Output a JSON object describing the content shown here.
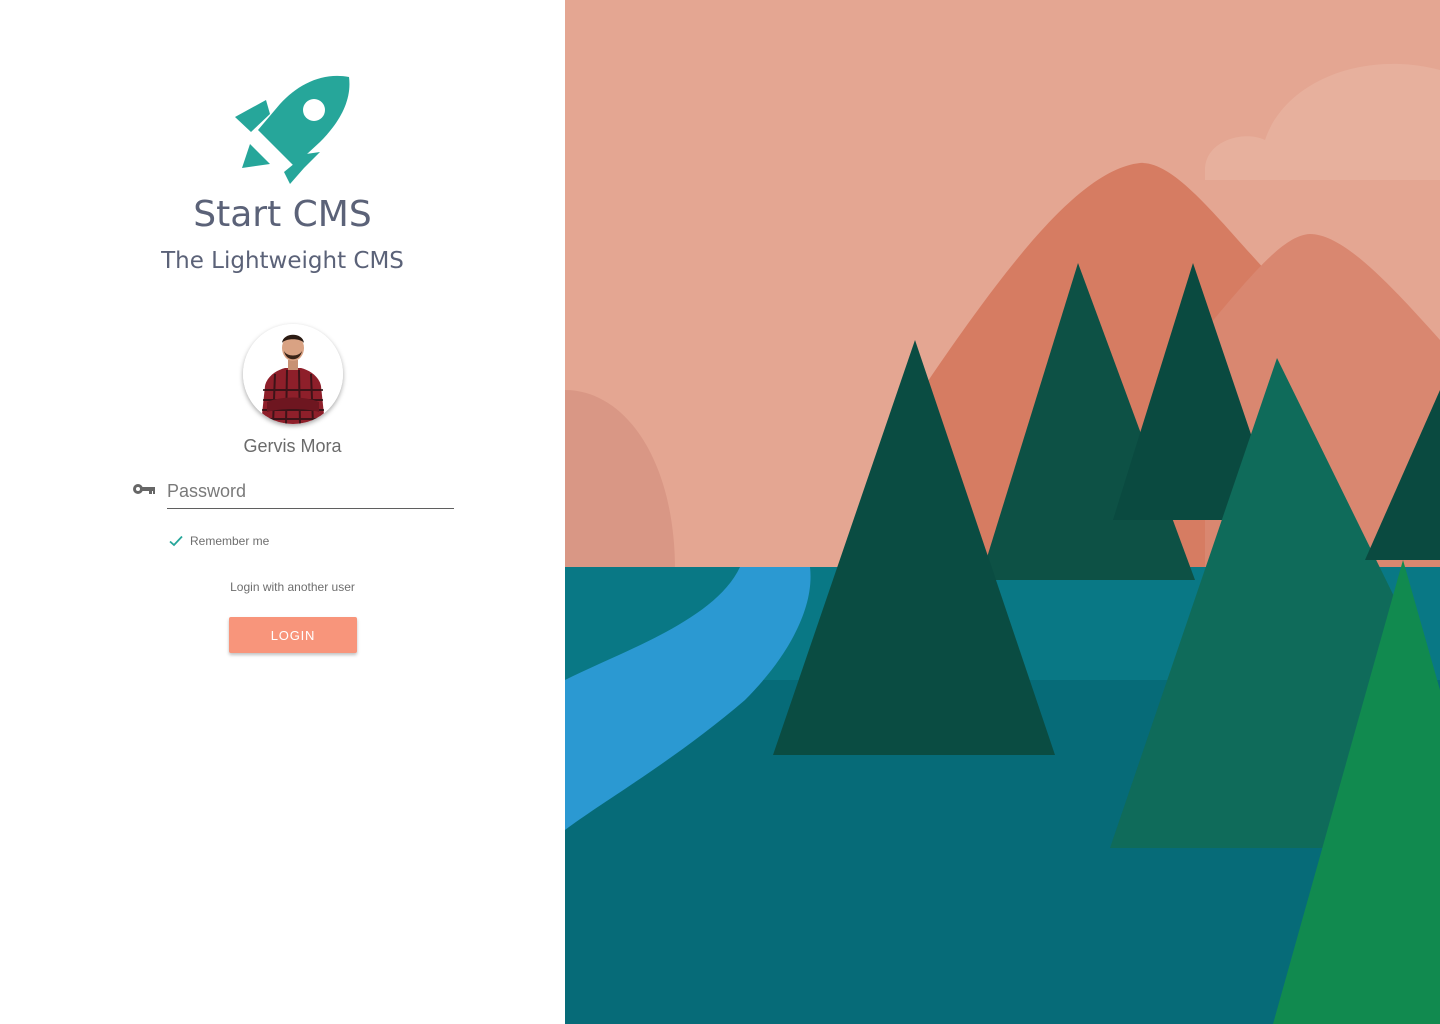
{
  "brand": {
    "title": "Start CMS",
    "subtitle": "The Lightweight CMS",
    "logo_icon": "rocket-icon",
    "accent_color": "#26a69a"
  },
  "user": {
    "name": "Gervis Mora",
    "avatar_icon": "user-avatar"
  },
  "form": {
    "password_placeholder": "Password",
    "password_icon": "key-icon",
    "remember_label": "Remember me",
    "remember_checked": true,
    "another_user_label": "Login with another user",
    "login_label": "LOGIN",
    "login_color": "#f8957b"
  },
  "illustration": {
    "subject": "mountain-lake-forest-illustration",
    "sky_color": "#e4a692",
    "mountain_color": "#d67c62",
    "water_color": "#066b78",
    "river_color": "#2b99d2",
    "tree_dark_color": "#0a4a40",
    "tree_light_color": "#118a4f"
  }
}
